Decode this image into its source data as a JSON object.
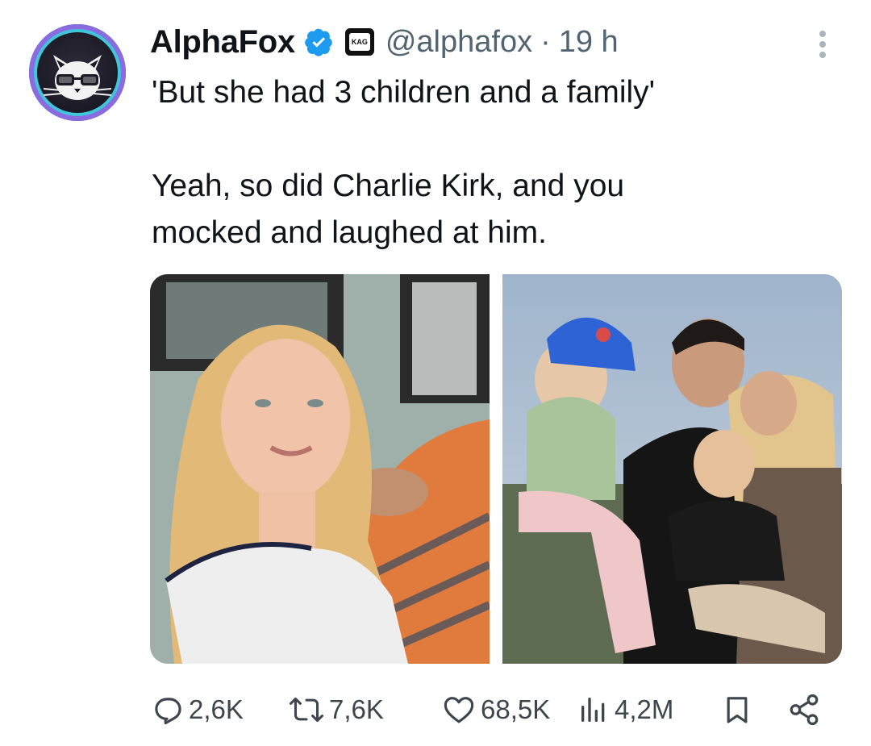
{
  "tweet": {
    "author_name": "AlphaFox",
    "handle": "@alphafox",
    "separator": "·",
    "time": "19 h",
    "affiliation_badge_text": "KAG",
    "text_line_1": "'But she had 3 children and a family'",
    "text_line_2": "Yeah, so did Charlie Kirk, and you",
    "text_line_3": "mocked and laughed at him."
  },
  "stats": {
    "replies": "2,6K",
    "reposts": "7,6K",
    "likes": "68,5K",
    "views": "4,2M"
  },
  "colors": {
    "verified": "#1d9bf0",
    "text": "#0f1419",
    "muted": "#536471",
    "icon": "#3d454d"
  },
  "icons": {
    "avatar": "cat-with-glasses-avatar",
    "verified": "verified-badge-icon",
    "more": "more-vertical-icon",
    "reply": "reply-icon",
    "repost": "repost-icon",
    "like": "heart-icon",
    "views": "views-bar-chart-icon",
    "bookmark": "bookmark-icon",
    "share": "share-icon"
  }
}
